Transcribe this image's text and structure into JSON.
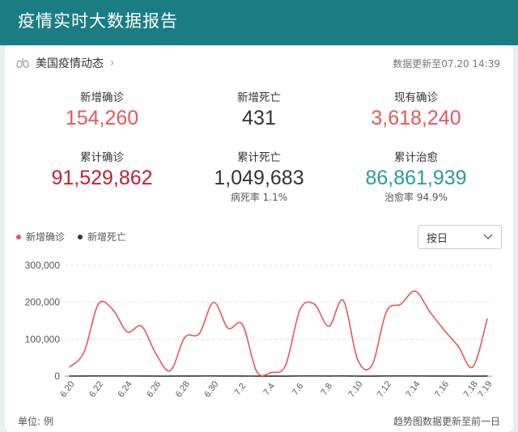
{
  "header": {
    "title": "疫情实时大数据报告"
  },
  "card": {
    "title": "美国疫情动态",
    "update_time": "数据更新至07.20 14:39"
  },
  "stats": {
    "new_confirmed": {
      "label": "新增确诊",
      "value": "154,260",
      "color": "#e05a58"
    },
    "new_deaths": {
      "label": "新增死亡",
      "value": "431",
      "color": "#333333"
    },
    "current_confirmed": {
      "label": "现有确诊",
      "value": "3,618,240",
      "color": "#e05a58"
    },
    "total_confirmed": {
      "label": "累计确诊",
      "value": "91,529,862",
      "color": "#c21f33"
    },
    "total_deaths": {
      "label": "累计死亡",
      "value": "1,049,683",
      "color": "#333333",
      "sub": "病死率 1.1%"
    },
    "total_recovered": {
      "label": "累计治愈",
      "value": "86,861,939",
      "color": "#2a9aa0",
      "sub": "治愈率 94.9%"
    }
  },
  "legend": [
    {
      "name": "新增确诊",
      "color": "#e05a58"
    },
    {
      "name": "新增死亡",
      "color": "#333333"
    }
  ],
  "range_select": {
    "value": "按日"
  },
  "footer": {
    "unit": "单位: 例",
    "note": "趋势图数据更新至前一日"
  },
  "chart_data": {
    "type": "line",
    "x": [
      "6.20",
      "6.21",
      "6.22",
      "6.23",
      "6.24",
      "6.25",
      "6.26",
      "6.27",
      "6.28",
      "6.29",
      "6.30",
      "7.1",
      "7.2",
      "7.3",
      "7.4",
      "7.5",
      "7.6",
      "7.7",
      "7.8",
      "7.9",
      "7.10",
      "7.11",
      "7.12",
      "7.13",
      "7.14",
      "7.15",
      "7.16",
      "7.17",
      "7.18",
      "7.19"
    ],
    "x_tick_labels": [
      "6.20",
      "6.22",
      "6.24",
      "6.26",
      "6.28",
      "6.30",
      "7.2",
      "7.4",
      "7.6",
      "7.8",
      "7.10",
      "7.12",
      "7.14",
      "7.16",
      "7.18",
      "7.19"
    ],
    "y_ticks": [
      "0",
      "100,000",
      "200,000",
      "300,000"
    ],
    "ylim": [
      0,
      300000
    ],
    "series": [
      {
        "name": "新增确诊",
        "color": "#e05a58",
        "values": [
          25000,
          65000,
          195000,
          180000,
          120000,
          135000,
          60000,
          15000,
          105000,
          115000,
          200000,
          130000,
          140000,
          12000,
          10000,
          30000,
          180000,
          195000,
          135000,
          205000,
          45000,
          30000,
          175000,
          195000,
          230000,
          175000,
          125000,
          80000,
          25000,
          155000
        ]
      },
      {
        "name": "新增死亡",
        "color": "#333333",
        "values": [
          300,
          500,
          600,
          700,
          550,
          500,
          300,
          150,
          450,
          500,
          600,
          450,
          450,
          80,
          60,
          200,
          550,
          600,
          500,
          600,
          250,
          150,
          550,
          600,
          650,
          500,
          450,
          350,
          150,
          431
        ]
      }
    ]
  }
}
